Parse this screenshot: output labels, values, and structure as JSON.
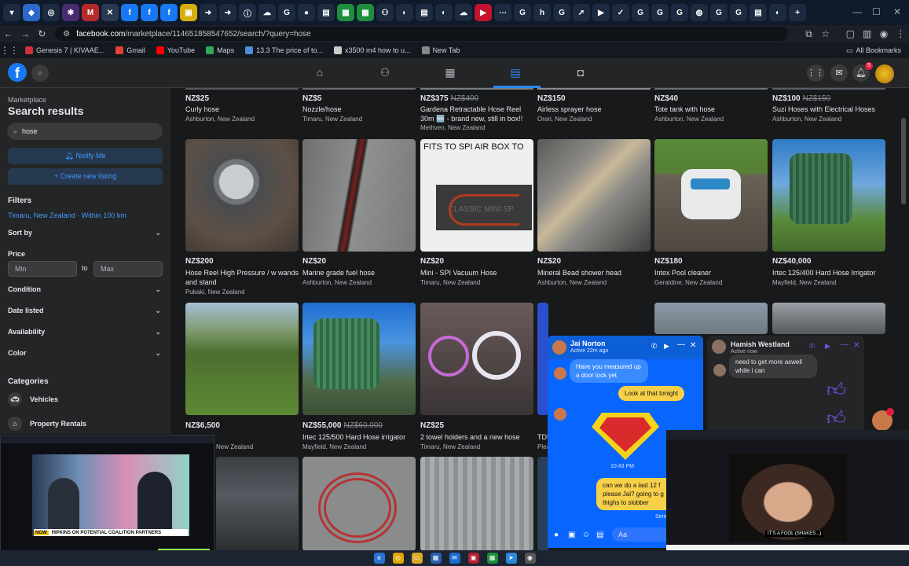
{
  "browser": {
    "url_host": "facebook.com",
    "url_path": "/marketplace/114651858547652/search/?query=hose",
    "bookmarks": [
      {
        "label": "Genesis 7 | KIVAAE...",
        "color": "#d03040"
      },
      {
        "label": "Gmail",
        "color": "#e44134"
      },
      {
        "label": "YouTube",
        "color": "#ff0000"
      },
      {
        "label": "Maps",
        "color": "#34a853"
      },
      {
        "label": "13.3 The price of to...",
        "color": "#4a90d9"
      },
      {
        "label": "x3500 m4 how to u...",
        "color": "#cccccc"
      },
      {
        "label": "New Tab",
        "color": "#888888"
      }
    ],
    "all_bookmarks": "All Bookmarks"
  },
  "fb": {
    "logo": "f",
    "notif_count": "5"
  },
  "sidebar": {
    "breadcrumb": "Marketplace",
    "title": "Search results",
    "search_value": "hose",
    "notify_label": "Notify Me",
    "create_label": "+ Create new listing",
    "filters_heading": "Filters",
    "location": "Timaru, New Zealand · Within 100 km",
    "sort_by": "Sort by",
    "price_label": "Price",
    "min_placeholder": "Min",
    "to": "to",
    "max_placeholder": "Max",
    "condition": "Condition",
    "date_listed": "Date listed",
    "availability": "Availability",
    "color": "Color",
    "categories_heading": "Categories",
    "cat_vehicles": "Vehicles",
    "cat_property": "Property Rentals"
  },
  "listings": {
    "row0": [
      {
        "price": "NZ$25",
        "old": "",
        "title": "Curly hose",
        "loc": "Ashburton, New Zealand"
      },
      {
        "price": "NZ$5",
        "old": "",
        "title": "Nozzle/hose",
        "loc": "Timaru, New Zealand"
      },
      {
        "price": "NZ$375",
        "old": "NZ$400",
        "title": "Gardena Retractable Hose Reel 30m 🆕 - brand new, still in box!!",
        "loc": "Methven, New Zealand"
      },
      {
        "price": "NZ$150",
        "old": "",
        "title": "Airless sprayer hose",
        "loc": "Orari, New Zealand"
      },
      {
        "price": "NZ$40",
        "old": "",
        "title": "Tote tank with hose",
        "loc": "Ashburton, New Zealand"
      },
      {
        "price": "NZ$100",
        "old": "NZ$150",
        "title": "Suzi Hoses with Electrical Hoses",
        "loc": "Ashburton, New Zealand"
      }
    ],
    "row1": [
      {
        "price": "NZ$200",
        "old": "",
        "title": "Hose Reel High Pressure / w wands and stand",
        "loc": "Pukaki, New Zealand"
      },
      {
        "price": "NZ$20",
        "old": "",
        "title": "Marine grade fuel hose",
        "loc": "Ashburton, New Zealand"
      },
      {
        "price": "NZ$20",
        "old": "",
        "title": "Mini - SPI Vacuum Hose",
        "loc": "Timaru, New Zealand"
      },
      {
        "price": "NZ$20",
        "old": "",
        "title": "Mineral Bead shower head",
        "loc": "Ashburton, New Zealand"
      },
      {
        "price": "NZ$180",
        "old": "",
        "title": "Intex Pool cleaner",
        "loc": "Geraldine, New Zealand"
      },
      {
        "price": "NZ$40,000",
        "old": "",
        "title": "Irtec 125/400 Hard Hose Irrigator",
        "loc": "Mayfield, New Zealand"
      }
    ],
    "row2": [
      {
        "price": "NZ$6,500",
        "old": "",
        "title": "",
        "loc": "New Zealand"
      },
      {
        "price": "NZ$55,000",
        "old": "NZ$60,000",
        "title": "Irtec 125/500 Hard Hose irrigator",
        "loc": "Mayfield, New Zealand"
      },
      {
        "price": "NZ$25",
        "old": "",
        "title": "2 towel holders and a new hose",
        "loc": "Timaru, New Zealand"
      },
      {
        "price": "",
        "old": "",
        "title": "TD5",
        "loc": "Plea"
      }
    ],
    "img_text_spi": "FITS TO SPI AIR BOX TO",
    "img_text_classic": "CLASSIC MINI SP"
  },
  "chat1": {
    "name": "Jai Norton",
    "status": "Active 22m ago",
    "msg1": "Have you measured up a door lock yet",
    "msg2": "Look at that tonight",
    "time": "10:43 PM",
    "msg3": "can we do a last 12 f please Jai? going to g thighs to slobber",
    "sent": "Sent",
    "input": "Aa"
  },
  "chat2": {
    "name": "Hamish Westland",
    "status": "Active now",
    "msg": "need to get more aswell while i can"
  },
  "video1": {
    "ticker": "HIPKINS ON POTENTIAL COALITION PARTNERS",
    "live": "NOW"
  },
  "video2": {
    "caption": "IT'S A FOOL (SHAKES...)"
  }
}
